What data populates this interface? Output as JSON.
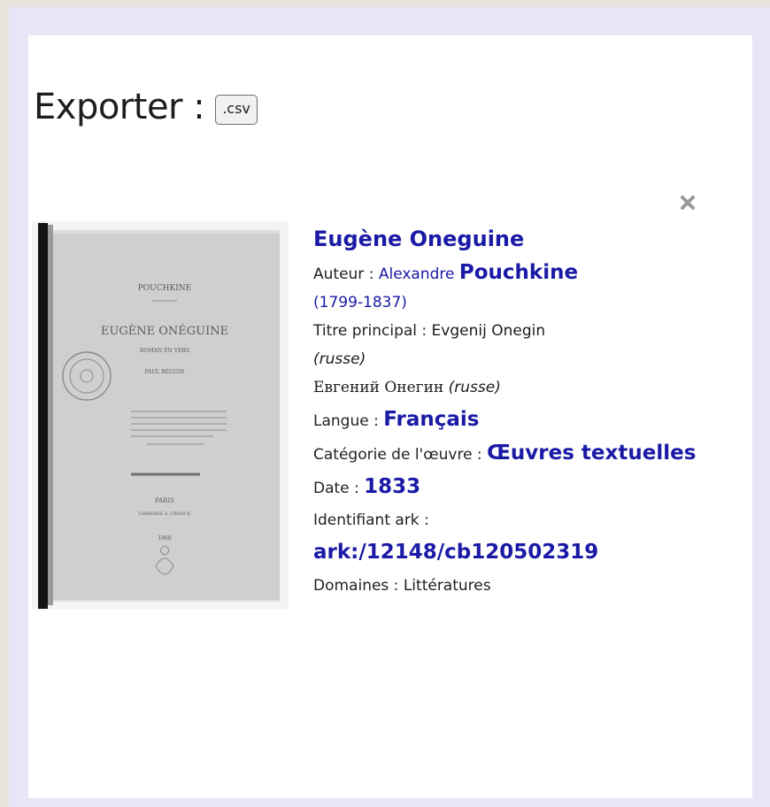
{
  "export": {
    "label": "Exporter :",
    "csv_button": ".csv"
  },
  "record": {
    "title": "Eugène Oneguine",
    "author": {
      "label": "Auteur :",
      "first_name": "Alexandre",
      "last_name": "Pouchkine",
      "dates": "(1799-1837)"
    },
    "main_title": {
      "label": "Titre principal :",
      "value": "Evgenij Onegin",
      "lang": "(russe)",
      "original": "Евгений Онегин",
      "original_lang": "(russe)"
    },
    "language": {
      "label": "Langue :",
      "value": "Français"
    },
    "category": {
      "label": "Catégorie de l'œuvre :",
      "value": "Œuvres textuelles"
    },
    "date": {
      "label": "Date :",
      "value": "1833"
    },
    "ark": {
      "label": "Identifiant ark :",
      "value": "ark:/12148/cb120502319"
    },
    "domains": {
      "label": "Domaines :",
      "value": "Littératures"
    }
  },
  "cover": {
    "author": "POUCHKINE",
    "title": "EUGÈNE ONÉGUINE",
    "subtitle": "ROMAN EN VERS",
    "translator": "PAUL BÉGUIN",
    "city": "PARIS",
    "publisher": "LIBRAIRIE A. FRANCK",
    "year": "1868"
  },
  "icons": {
    "close": "close-icon"
  },
  "colors": {
    "link": "#1a1aa6",
    "panel_bg": "#ffffff",
    "frame_bg": "#e6e6f6"
  }
}
